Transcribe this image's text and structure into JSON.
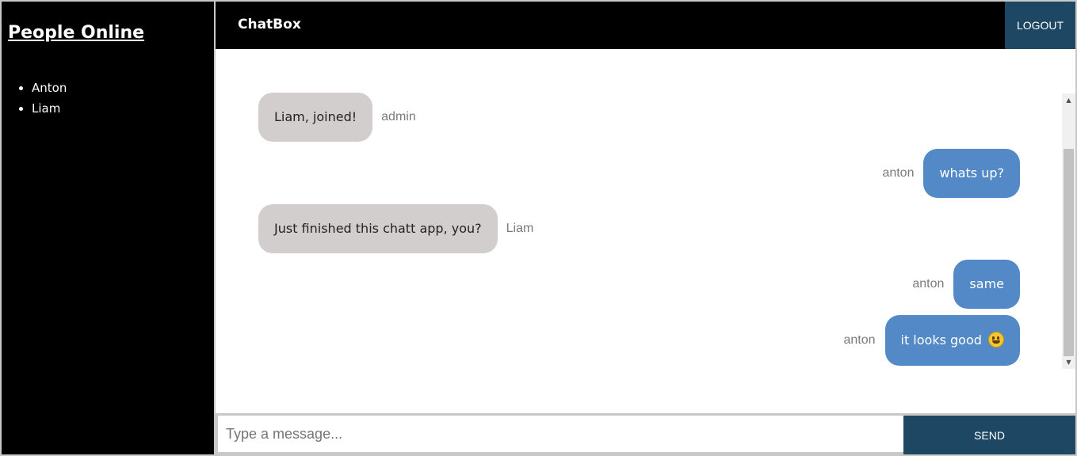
{
  "sidebar": {
    "title": "People Online",
    "users": [
      "Anton",
      "Liam"
    ]
  },
  "header": {
    "brand": "ChatBox",
    "logout_label": "LOGOUT"
  },
  "messages": [
    {
      "text": "Liam, joined!",
      "sender": "admin",
      "side": "left"
    },
    {
      "text": "whats up?",
      "sender": "anton",
      "side": "right"
    },
    {
      "text": "Just finished this chatt app, you?",
      "sender": "Liam",
      "side": "left"
    },
    {
      "text": "same",
      "sender": "anton",
      "side": "right"
    },
    {
      "text": "it looks good",
      "emoji": "smiley-icon",
      "sender": "anton",
      "side": "right"
    }
  ],
  "composer": {
    "placeholder": "Type a message...",
    "value": "",
    "send_label": "SEND"
  },
  "colors": {
    "dark": "#000000",
    "accent": "#1e4763",
    "own_bubble": "#5389c7",
    "other_bubble": "#d3cece"
  }
}
